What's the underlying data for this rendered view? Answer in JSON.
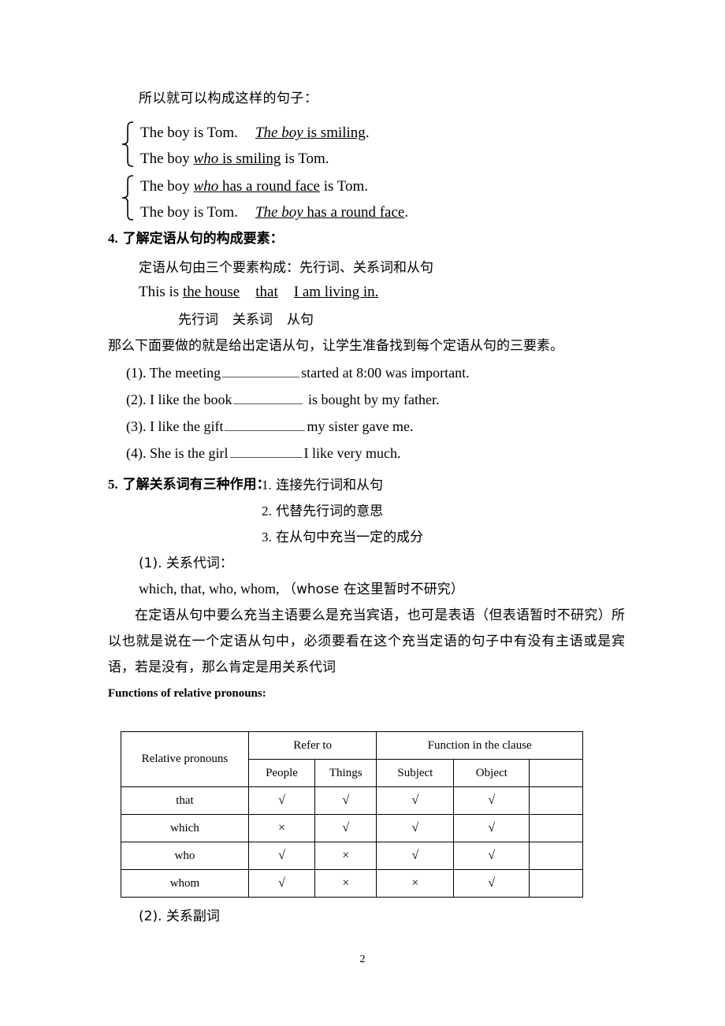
{
  "document": {
    "page_number": "2"
  },
  "intro": {
    "text": "所以就可以构成这样的句子："
  },
  "brace_groups": [
    {
      "lines": [
        {
          "segments": [
            {
              "text": "The boy is Tom.",
              "style": "plain"
            },
            {
              "text": "The boy",
              "style": "italic-underline"
            },
            {
              "text": " is smiling",
              "style": "underline"
            },
            {
              "text": ".",
              "style": "plain"
            }
          ]
        },
        {
          "segments": [
            {
              "text": "The boy ",
              "style": "plain"
            },
            {
              "text": "who",
              "style": "italic-underline"
            },
            {
              "text": " is smiling",
              "style": "underline"
            },
            {
              "text": " is Tom.",
              "style": "plain"
            }
          ]
        }
      ]
    },
    {
      "lines": [
        {
          "segments": [
            {
              "text": "The boy ",
              "style": "plain"
            },
            {
              "text": "who",
              "style": "italic-underline"
            },
            {
              "text": " has a round face",
              "style": "underline"
            },
            {
              "text": " is Tom.",
              "style": "plain"
            }
          ]
        },
        {
          "segments": [
            {
              "text": "The boy is Tom.",
              "style": "plain"
            },
            {
              "text": "The boy",
              "style": "italic-underline"
            },
            {
              "text": " has a round face",
              "style": "underline"
            },
            {
              "text": ".",
              "style": "plain"
            }
          ]
        }
      ]
    }
  ],
  "section4": {
    "number": "4.",
    "title": "了解定语从句的构成要素：",
    "elements_line": "定语从句由三个要素构成：先行词、关系词和从句",
    "example": {
      "lead": "This is ",
      "antecedent": "the house",
      "relative_word": "that",
      "clause": "I am living in."
    },
    "labels": {
      "antecedent": "先行词",
      "relative_word": "关系词",
      "clause": "从句"
    },
    "task_line": "那么下面要做的就是给出定语从句，让学生准备找到每个定语从句的三要素。",
    "exercises": [
      {
        "number": "(1).",
        "before": "The meeting",
        "after": "started at 8:00 was important."
      },
      {
        "number": "(2).",
        "before": "I like the book",
        "after": "is bought by my father."
      },
      {
        "number": "(3).",
        "before": "I like the gift",
        "after": "my sister gave me."
      },
      {
        "number": "(4).",
        "before": "She is the girl",
        "after": "I like very much."
      }
    ]
  },
  "section5": {
    "number": "5.",
    "title": "了解关系词有三种作用：",
    "functions": [
      {
        "number": "1.",
        "text": "连接先行词和从句"
      },
      {
        "number": "2.",
        "text": "代替先行词的意思"
      },
      {
        "number": "3.",
        "text": "在从句中充当一定的成分"
      }
    ],
    "sub1_label": "(1).  关系代词：",
    "pronoun_list": "which, that, who, whom,",
    "pronoun_note": "（whose 在这里暂时不研究）",
    "explanation": "在定语从句中要么充当主语要么是充当宾语，也可是表语（但表语暂时不研究）所以也就是说在一个定语从句中，必须要看在这个充当定语的句子中有没有主语或是宾语，若是没有，那么肯定是用关系代词",
    "sub2_label": "(2).  关系副词"
  },
  "table": {
    "caption": "Functions of relative pronouns:",
    "group_headers": {
      "pronouns": "Relative pronouns",
      "refer_to": "Refer to",
      "function": "Function in the clause"
    },
    "sub_headers": [
      "People",
      "Things",
      "Subject",
      "Object",
      ""
    ],
    "rows": [
      {
        "pronoun": "that",
        "people": "√",
        "things": "√",
        "subject": "√",
        "object": "√",
        "extra": ""
      },
      {
        "pronoun": "which",
        "people": "×",
        "things": "√",
        "subject": "√",
        "object": "√",
        "extra": ""
      },
      {
        "pronoun": "who",
        "people": "√",
        "things": "×",
        "subject": "√",
        "object": "√",
        "extra": ""
      },
      {
        "pronoun": "whom",
        "people": "√",
        "things": "×",
        "subject": "×",
        "object": "√",
        "extra": ""
      }
    ]
  }
}
